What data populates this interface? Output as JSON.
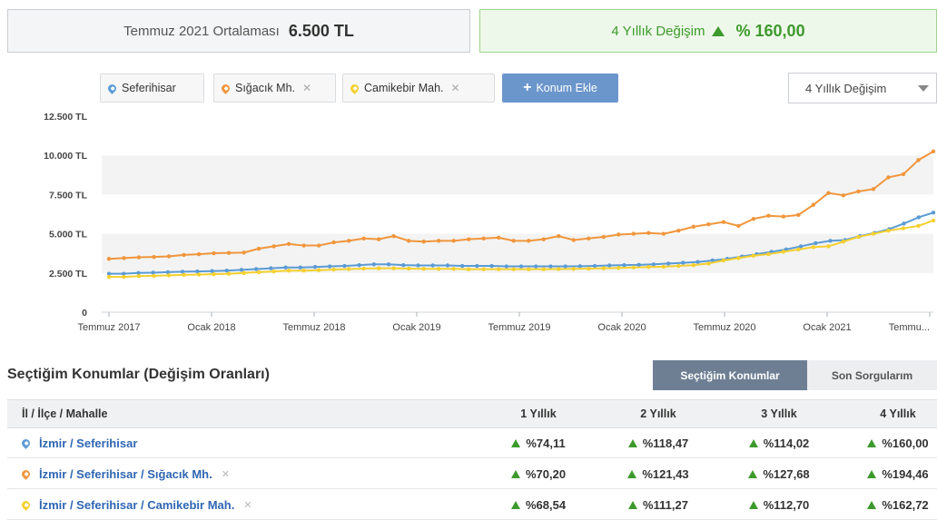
{
  "summary": {
    "avg_label": "Temmuz 2021 Ortalaması",
    "avg_value": "6.500 TL",
    "change_label": "4 Yıllık Değişim",
    "change_value": "% 160,00",
    "change_color": "#3c9a2c"
  },
  "locations": [
    {
      "name": "Seferihisar",
      "color": "#5b9bd5",
      "removable": false
    },
    {
      "name": "Sığacık Mh.",
      "color": "#f0963c",
      "removable": true
    },
    {
      "name": "Camikebir Mah.",
      "color": "#f5d02f",
      "removable": true
    }
  ],
  "add_location_label": "Konum Ekle",
  "period_select": {
    "selected": "4 Yıllık Değişim"
  },
  "chart_data": {
    "type": "line",
    "x": [
      "2017-07",
      "2017-08",
      "2017-09",
      "2017-10",
      "2017-11",
      "2017-12",
      "2018-01",
      "2018-02",
      "2018-03",
      "2018-04",
      "2018-05",
      "2018-06",
      "2018-07",
      "2018-08",
      "2018-09",
      "2018-10",
      "2018-11",
      "2018-12",
      "2019-01",
      "2019-02",
      "2019-03",
      "2019-04",
      "2019-05",
      "2019-06",
      "2019-07",
      "2019-08",
      "2019-09",
      "2019-10",
      "2019-11",
      "2019-12",
      "2020-01",
      "2020-02",
      "2020-03",
      "2020-04",
      "2020-05",
      "2020-06",
      "2020-07",
      "2020-08",
      "2020-09",
      "2020-10",
      "2020-11",
      "2020-12",
      "2021-01",
      "2021-02",
      "2021-03",
      "2021-04",
      "2021-05",
      "2021-06",
      "2021-07"
    ],
    "tick_labels": [
      "Temmuz 2017",
      "Ocak 2018",
      "Temmuz 2018",
      "Ocak 2019",
      "Temmuz 2019",
      "Ocak 2020",
      "Temmuz 2020",
      "Ocak 2021",
      "Temmu..."
    ],
    "y_tick_labels": [
      "0",
      "2.500 TL",
      "5.000 TL",
      "7.500 TL",
      "10.000 TL",
      "12.500 TL"
    ],
    "ylim": [
      0,
      12500
    ],
    "grid": true,
    "series": [
      {
        "name": "Sığacık Mh.",
        "color": "#f0963c",
        "values": [
          3400,
          3450,
          3500,
          3520,
          3560,
          3650,
          3700,
          3760,
          3780,
          3800,
          4050,
          4200,
          4350,
          4250,
          4250,
          4450,
          4550,
          4700,
          4650,
          4850,
          4550,
          4500,
          4550,
          4550,
          4650,
          4700,
          4750,
          4550,
          4550,
          4650,
          4850,
          4600,
          4700,
          4800,
          4950,
          5000,
          5050,
          5000,
          5200,
          5450,
          5600,
          5750,
          5500,
          5950,
          6150,
          6100,
          6200,
          6850,
          7600,
          7450,
          7700,
          7850,
          8600,
          8800,
          9700,
          10250
        ]
      },
      {
        "name": "Seferihisar",
        "color": "#5b9bd5",
        "values": [
          2450,
          2450,
          2500,
          2520,
          2550,
          2580,
          2600,
          2620,
          2650,
          2700,
          2750,
          2800,
          2850,
          2850,
          2880,
          2920,
          2950,
          3000,
          3050,
          3050,
          3000,
          2980,
          2980,
          2980,
          2950,
          2950,
          2950,
          2920,
          2920,
          2920,
          2920,
          2920,
          2930,
          2950,
          2980,
          3000,
          3020,
          3050,
          3100,
          3150,
          3200,
          3300,
          3400,
          3550,
          3700,
          3850,
          4000,
          4200,
          4400,
          4550,
          4600,
          4850,
          5050,
          5300,
          5650,
          6050,
          6350
        ]
      },
      {
        "name": "Camikebir Mah.",
        "color": "#f5d02f",
        "values": [
          2250,
          2250,
          2300,
          2320,
          2350,
          2380,
          2400,
          2420,
          2450,
          2500,
          2550,
          2600,
          2650,
          2650,
          2680,
          2720,
          2750,
          2780,
          2800,
          2800,
          2780,
          2760,
          2760,
          2760,
          2740,
          2740,
          2740,
          2740,
          2740,
          2740,
          2750,
          2760,
          2780,
          2800,
          2820,
          2850,
          2880,
          2900,
          2950,
          3000,
          3100,
          3300,
          3450,
          3600,
          3700,
          3850,
          4000,
          4150,
          4200,
          4500,
          4800,
          5000,
          5200,
          5350,
          5500,
          5850
        ]
      }
    ]
  },
  "table": {
    "section_title": "Seçtiğim Konumlar (Değişim Oranları)",
    "tabs": [
      "Seçtiğim Konumlar",
      "Son Sorgularım"
    ],
    "headers": [
      "İl / İlçe / Mahalle",
      "1 Yıllık",
      "2 Yıllık",
      "3 Yıllık",
      "4 Yıllık"
    ],
    "rows": [
      {
        "name": "İzmir / Seferihisar",
        "color": "#5b9bd5",
        "v1": "%74,11",
        "v2": "%118,47",
        "v3": "%114,02",
        "v4": "%160,00"
      },
      {
        "name": "İzmir / Seferihisar / Sığacık Mh.",
        "color": "#f0963c",
        "v1": "%70,20",
        "v2": "%121,43",
        "v3": "%127,68",
        "v4": "%194,46"
      },
      {
        "name": "İzmir / Seferihisar / Camikebir Mah.",
        "color": "#f5d02f",
        "v1": "%68,54",
        "v2": "%111,27",
        "v3": "%112,70",
        "v4": "%162,72"
      }
    ]
  }
}
